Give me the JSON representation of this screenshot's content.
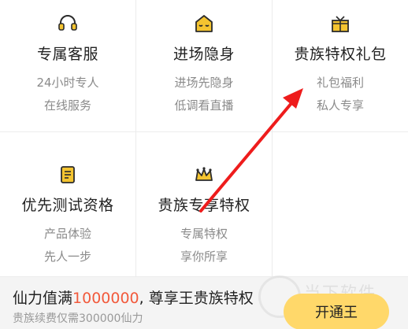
{
  "privileges": [
    {
      "title": "专属客服",
      "desc": [
        "24小时专人",
        "在线服务"
      ],
      "icon": "headset-icon"
    },
    {
      "title": "进场隐身",
      "desc": [
        "进场先隐身",
        "低调看直播"
      ],
      "icon": "stealth-icon"
    },
    {
      "title": "贵族特权礼包",
      "desc": [
        "礼包福利",
        "私人专享"
      ],
      "icon": "gift-icon"
    },
    {
      "title": "优先测试资格",
      "desc": [
        "产品体验",
        "先人一步"
      ],
      "icon": "document-icon"
    },
    {
      "title": "贵族专享特权",
      "desc": [
        "专属特权",
        "享你所享"
      ],
      "icon": "crown-icon"
    }
  ],
  "footer": {
    "headline_prefix": "仙力值满",
    "headline_value": "1000000",
    "headline_suffix": ", 尊享王贵族特权",
    "subline": "贵族续费仅需300000仙力",
    "button_label": "开通王"
  },
  "watermark_text": "当下软件园",
  "colors": {
    "accent": "#ffd86a",
    "highlight": "#f25a3c",
    "icon": "#f4c430",
    "arrow": "#ee1c1c"
  }
}
